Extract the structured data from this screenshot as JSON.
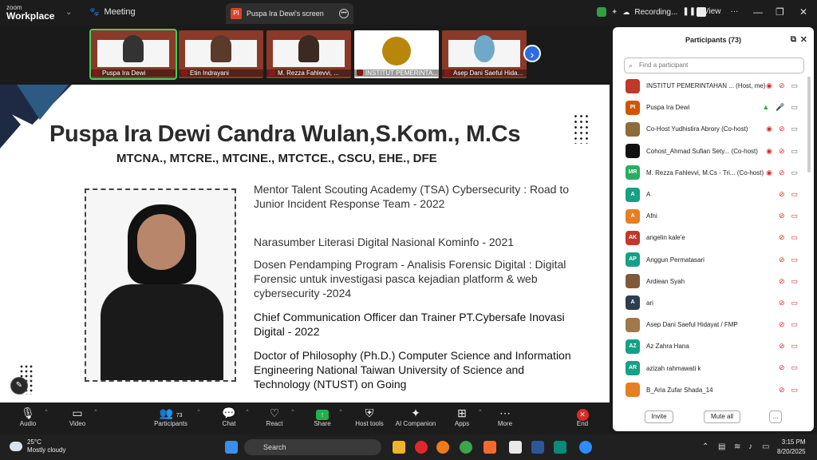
{
  "titlebar": {
    "app_top": "zoom",
    "app_bottom": "Workplace",
    "meeting_label": "Meeting",
    "tab_icon_text": "PI",
    "tab_label": "Puspa Ira Dewi's screen",
    "recording_label": "Recording...",
    "view_label": "View"
  },
  "thumbnails": [
    {
      "name": "Puspa Ira Dewi",
      "active": true
    },
    {
      "name": "Etin Indrayani",
      "active": false
    },
    {
      "name": "M. Rezza Fahlevvi, ...",
      "active": false
    },
    {
      "name": "INSTITUT PEMERINTA...",
      "active": false
    },
    {
      "name": "Asep Dani Saeful Hida...",
      "active": false
    }
  ],
  "slide": {
    "title": "Puspa Ira Dewi Candra Wulan,S.Kom., M.Cs",
    "subtitle": "MTCNA., MTCRE., MTCINE., MTCTCE., CSCU, EHE., DFE",
    "bio": [
      "Mentor Talent Scouting Academy (TSA) Cybersecurity : Road to Junior Incident Response Team - 2022",
      "Narasumber Literasi Digital Nasional Kominfo - 2021",
      "Dosen Pendamping Program -  Analisis Forensic Digital : Digital Forensic untuk investigasi pasca kejadian platform & web cybersecurity -2024",
      "Chief Communication Officer dan Trainer PT.Cybersafe Inovasi Digital - 2022",
      "Doctor of Philosophy (Ph.D.) Computer Science and Information Engineering National Taiwan University of Science and Technology (NTUST) on Going"
    ]
  },
  "toolbar": {
    "audio": "Audio",
    "video": "Video",
    "participants": "Participants",
    "participants_count": "73",
    "chat": "Chat",
    "react": "React",
    "share": "Share",
    "host_tools": "Host tools",
    "ai_companion": "AI Companion",
    "apps": "Apps",
    "more": "More",
    "end": "End"
  },
  "participants_panel": {
    "title": "Participants (73)",
    "search_placeholder": "Find a participant",
    "invite": "Invite",
    "mute_all": "Mute all",
    "more": "...",
    "list": [
      {
        "initials": "",
        "color": "#c0392b",
        "name": "INSTITUT PEMERINTAHAN ... (Host, me)",
        "video": "on",
        "mic": "muted"
      },
      {
        "initials": "PI",
        "color": "#d35400",
        "name": "Puspa Ira Dewi",
        "video": "share",
        "mic": "on"
      },
      {
        "initials": "",
        "color": "#8e6b3a",
        "name": "Co-Host Yudhistira Abrory (Co-host)",
        "video": "on",
        "mic": "muted"
      },
      {
        "initials": "",
        "color": "#111111",
        "name": "Cohost_Ahmad Sufian Sety... (Co-host)",
        "video": "on",
        "mic": "muted"
      },
      {
        "initials": "MR",
        "color": "#27ae60",
        "name": "M. Rezza Fahlevvi, M.Cs - Tri... (Co-host)",
        "video": "on",
        "mic": "muted"
      },
      {
        "initials": "A",
        "color": "#16a085",
        "name": "A",
        "video": "off",
        "mic": "muted"
      },
      {
        "initials": "A",
        "color": "#e67e22",
        "name": "Afni",
        "video": "off",
        "mic": "muted"
      },
      {
        "initials": "AK",
        "color": "#c0392b",
        "name": "angelin kale'e",
        "video": "off",
        "mic": "muted"
      },
      {
        "initials": "AP",
        "color": "#16a085",
        "name": "Anggun Permatasari",
        "video": "off",
        "mic": "muted"
      },
      {
        "initials": "",
        "color": "#7f5a3a",
        "name": "Ardiean Syah",
        "video": "off",
        "mic": "muted"
      },
      {
        "initials": "A",
        "color": "#2c3e50",
        "name": "ari",
        "video": "off",
        "mic": "muted"
      },
      {
        "initials": "",
        "color": "#a0784a",
        "name": "Asep Dani Saeful Hidayat / FMP",
        "video": "off",
        "mic": "muted"
      },
      {
        "initials": "AZ",
        "color": "#16a085",
        "name": "Az Zahra Hana",
        "video": "off",
        "mic": "muted"
      },
      {
        "initials": "AR",
        "color": "#16a085",
        "name": "azizah rahmawati k",
        "video": "off",
        "mic": "muted"
      },
      {
        "initials": "",
        "color": "#e67e22",
        "name": "B_Aria Zufar Shada_14",
        "video": "off",
        "mic": "muted"
      }
    ]
  },
  "taskbar": {
    "temp": "25°C",
    "weather": "Mostly cloudy",
    "search": "Search",
    "time": "3:15 PM",
    "date": "8/20/2025"
  }
}
